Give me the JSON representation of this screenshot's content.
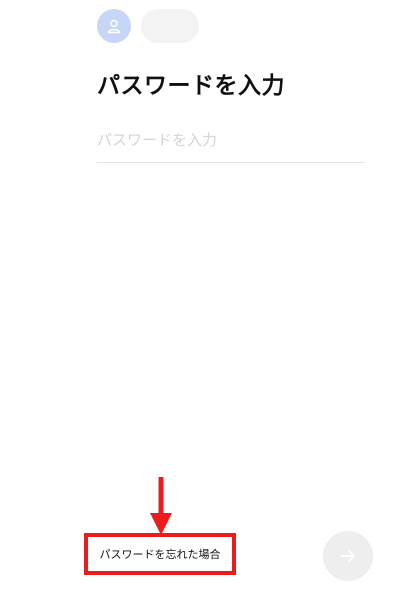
{
  "account": {
    "avatar_icon": "person-icon",
    "name": ""
  },
  "title": "パスワードを入力",
  "password": {
    "placeholder": "パスワードを入力",
    "value": ""
  },
  "forgot_link": "パスワードを忘れた場合",
  "next_button": {
    "icon": "arrow-right-icon",
    "enabled": false
  },
  "annotation": {
    "arrow_icon": "arrow-down-icon",
    "color": "#ec1c1c"
  },
  "colors": {
    "avatar_bg": "#c6d6f7",
    "disabled_button": "#eeeeee",
    "placeholder": "#d4d4d4"
  }
}
